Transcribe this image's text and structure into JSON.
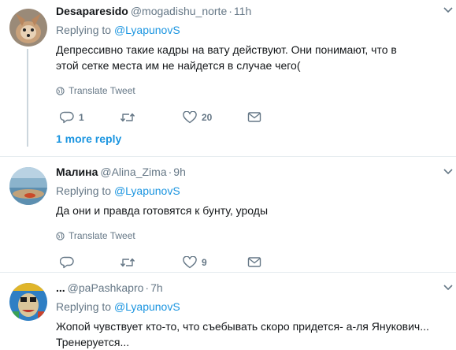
{
  "tweets": [
    {
      "name": "Desaparesido",
      "handle": "@mogadishu_norte",
      "dot": "·",
      "time": "11h",
      "reply_prefix": "Replying to",
      "reply_mention": "@LyapunovS",
      "text": "Депрессивно такие кадры на вату действуют. Они понимают, что в этой сетке места им не найдется в случае чего(",
      "translate": "Translate Tweet",
      "replies": "1",
      "retweets": "",
      "likes": "20",
      "more_reply": "1 more reply"
    },
    {
      "name": "Малина",
      "handle": "@Alina_Zima",
      "dot": "·",
      "time": "9h",
      "reply_prefix": "Replying to",
      "reply_mention": "@LyapunovS",
      "text": "Да они и правда готовятся к бунту, уроды",
      "translate": "Translate Tweet",
      "replies": "",
      "retweets": "",
      "likes": "9"
    },
    {
      "name": "...",
      "handle": "@paPashkapro",
      "dot": "·",
      "time": "7h",
      "reply_prefix": "Replying to",
      "reply_mention": "@LyapunovS",
      "text": "Жопой чувствует кто-то, что съебывать скоро придется- а-ля Янукович... Тренеруется..."
    }
  ],
  "colors": {
    "link": "#1b95e0",
    "muted": "#657786",
    "divider": "#e6ecf0",
    "thread_line": "#ccd6dd"
  },
  "icons": [
    "caret-down-icon",
    "globe-icon",
    "reply-icon",
    "retweet-icon",
    "like-icon",
    "message-icon"
  ]
}
